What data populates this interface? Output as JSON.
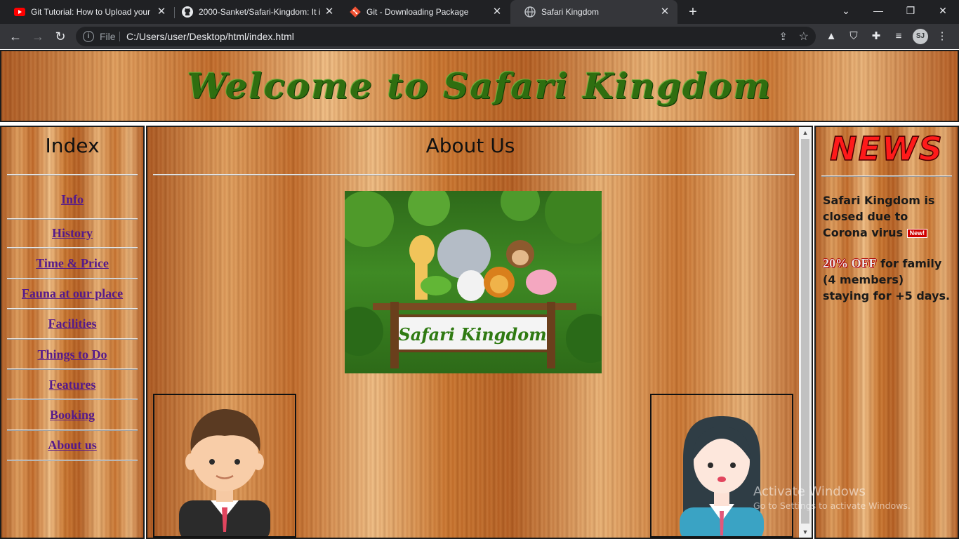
{
  "browser": {
    "tabs": [
      {
        "title": "Git Tutorial: How to Upload your",
        "icon": "youtube-icon"
      },
      {
        "title": "2000-Sanket/Safari-Kingdom: It i",
        "icon": "github-icon"
      },
      {
        "title": "Git - Downloading Package",
        "icon": "git-icon"
      },
      {
        "title": "Safari Kingdom",
        "icon": "globe-icon",
        "active": true
      }
    ],
    "address": {
      "scheme": "File",
      "url": "C:/Users/user/Desktop/html/index.html"
    },
    "profile_initials": "SJ"
  },
  "page": {
    "header_title": "Welcome to Safari Kingdom",
    "index": {
      "title": "Index",
      "links": [
        "Info",
        "History",
        "Time & Price",
        "Fauna at our place",
        "Facilities",
        "Things to Do",
        "Features",
        "Booking",
        "About us"
      ]
    },
    "main": {
      "title": "About Us",
      "image_caption": "Safari Kingdom"
    },
    "news": {
      "title": "NEWS",
      "item1": "Safari Kingdom is closed due to Corona virus",
      "new_badge": "New!",
      "item2_highlight": "20% OFF",
      "item2_rest": "for family (4 members) staying for +5 days."
    }
  },
  "watermark": {
    "line1": "Activate Windows",
    "line2": "Go to Settings to activate Windows."
  },
  "colors": {
    "link": "#551a8b",
    "news_title": "#ff1a1a",
    "header_title": "#2f6e10",
    "wood": "#c87a3c"
  }
}
